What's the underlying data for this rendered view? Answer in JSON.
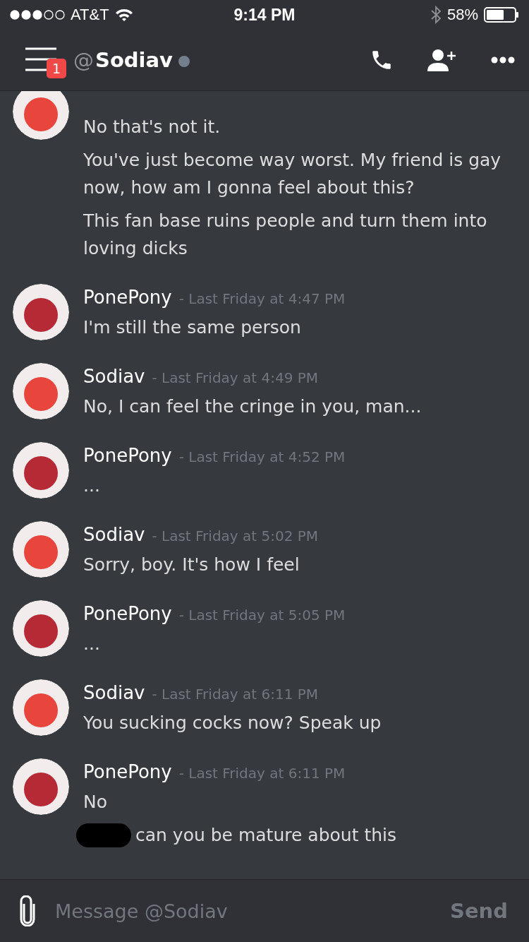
{
  "status_bar": {
    "carrier": "AT&T",
    "time": "9:14 PM",
    "battery": "58%"
  },
  "header": {
    "badge": "1",
    "at": "@",
    "title": "Sodiav"
  },
  "messages": [
    {
      "color": "#e8453c",
      "lines": [
        {
          "text": "No that's not it.",
          "redacted": false
        },
        {
          "text": "You've just become way worst. My friend is gay now, how am I gonna feel about this?",
          "redacted": false
        },
        {
          "text": "This fan base ruins people and turn them into loving dicks",
          "redacted": false
        }
      ]
    },
    {
      "color": "#b52a35",
      "author": "PonePony",
      "time": "- Last Friday at 4:47 PM",
      "lines": [
        {
          "text": "I'm still the same person",
          "redacted": false
        }
      ]
    },
    {
      "color": "#e8453c",
      "author": "Sodiav",
      "time": "- Last Friday at 4:49 PM",
      "lines": [
        {
          "text": "No, I can feel the cringe in you, man...",
          "redacted": false
        }
      ]
    },
    {
      "color": "#b52a35",
      "author": "PonePony",
      "time": "- Last Friday at 4:52 PM",
      "lines": [
        {
          "text": "...",
          "redacted": false
        }
      ]
    },
    {
      "color": "#e8453c",
      "author": "Sodiav",
      "time": "- Last Friday at 5:02 PM",
      "lines": [
        {
          "text": "Sorry, boy. It's how I feel",
          "redacted": false
        }
      ]
    },
    {
      "color": "#b52a35",
      "author": "PonePony",
      "time": "- Last Friday at 5:05 PM",
      "lines": [
        {
          "text": "...",
          "redacted": false
        }
      ]
    },
    {
      "color": "#e8453c",
      "author": "Sodiav",
      "time": "- Last Friday at 6:11 PM",
      "lines": [
        {
          "text": "You sucking cocks now? Speak up",
          "redacted": false
        }
      ]
    },
    {
      "color": "#b52a35",
      "author": "PonePony",
      "time": "- Last Friday at 6:11 PM",
      "lines": [
        {
          "text": "No",
          "redacted": false
        },
        {
          "text": "can you be mature about this",
          "redacted": true
        }
      ]
    }
  ],
  "composer": {
    "placeholder": "Message @Sodiav",
    "send": "Send"
  }
}
